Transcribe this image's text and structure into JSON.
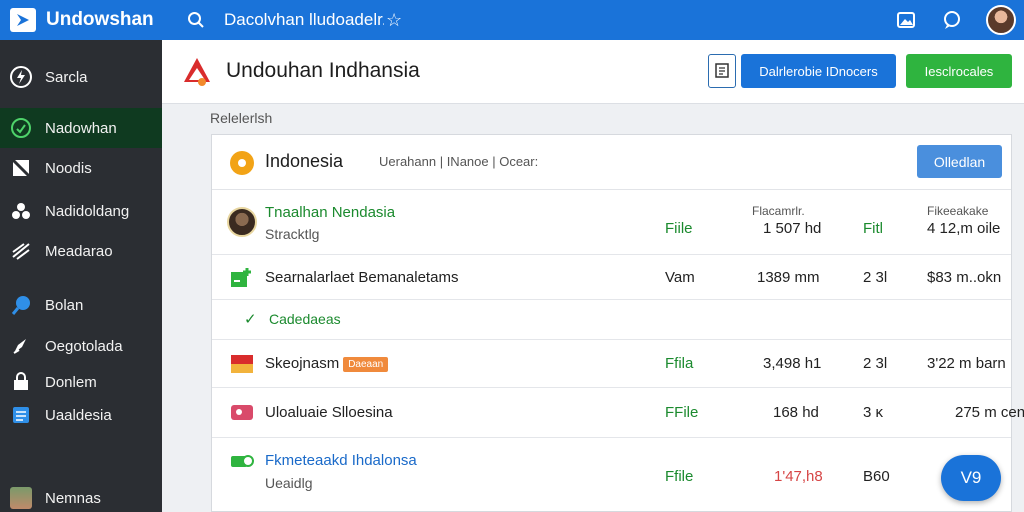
{
  "app": {
    "name": "Undowshan",
    "search_value": "Dacolvhan lludoadelr."
  },
  "sidebar": {
    "items": [
      {
        "label": "Sarcla"
      },
      {
        "label": "Nadowhan"
      },
      {
        "label": "Noodis"
      },
      {
        "label": "Nadidoldang"
      },
      {
        "label": "Meadarao"
      },
      {
        "label": "Bolan"
      },
      {
        "label": "Oegotolada"
      },
      {
        "label": "Donlem"
      },
      {
        "label": "Uaaldesia"
      },
      {
        "label": "Nemnas"
      }
    ]
  },
  "header": {
    "title": "Undouhan Indhansia",
    "primary_button": "Dalrlerobie IDnocers",
    "green_button": "Iesclrocales"
  },
  "section_label": "Relelerlsh",
  "panel": {
    "title": "Indonesia",
    "meta": "Uerahann  |  INanoe  |  Ocear:",
    "action_button": "Olledlan",
    "col_header_a": "Flacamrlr.",
    "col_header_b": "Fikeeakake"
  },
  "rows": [
    {
      "name": "Tnaalhan Nendasia",
      "sub": "Stracktlg",
      "type": "Fiile",
      "size": "1 507 hd",
      "kind": "Fitl",
      "value": "4 12,m oile"
    },
    {
      "name": "Searnalarlaet Bemanaletams",
      "sub": "",
      "type": "Vam",
      "size": "1389 mm",
      "kind": "2 3l",
      "value": "$83 m..okn"
    },
    {
      "name": "Cadedaeas",
      "sub": "",
      "type": "",
      "size": "",
      "kind": "",
      "value": ""
    },
    {
      "name": "Skeojnasm",
      "badge": "Daeaan",
      "sub": "",
      "type": "Ffila",
      "size": "3,498 h1",
      "kind": "2 3l",
      "value": "3'22 m barn"
    },
    {
      "name": "Uloaluaie Slloesina",
      "sub": "",
      "type": "FFile",
      "size": "168 hd",
      "kind": "3 ĸ",
      "value": "275 m cen"
    },
    {
      "name": "Fkmeteaakd Ihdalonsa",
      "sub": "Ueaidlg",
      "type": "Ffile",
      "size": "1'47,h8",
      "kind": "B60",
      "value": ""
    }
  ],
  "fab_label": "V9",
  "colors": {
    "topbar": "#1a73d9",
    "sidebar": "#2b2e33",
    "active_item": "#0f3a20",
    "green_button": "#2fb43f",
    "text_green": "#1b8a2e",
    "badge": "#f08a3c",
    "red_value": "#d64545"
  },
  "icons": {
    "brand": "play-triangle-icon",
    "search": "search-icon",
    "star": "star-icon",
    "top": [
      "image-icon",
      "chat-icon"
    ],
    "sidebar": [
      "bolt-icon",
      "whatsapp-icon",
      "note-icon",
      "cluster-icon",
      "wind-icon",
      "pin-icon",
      "rocket-icon",
      "lock-icon",
      "document-icon"
    ]
  }
}
